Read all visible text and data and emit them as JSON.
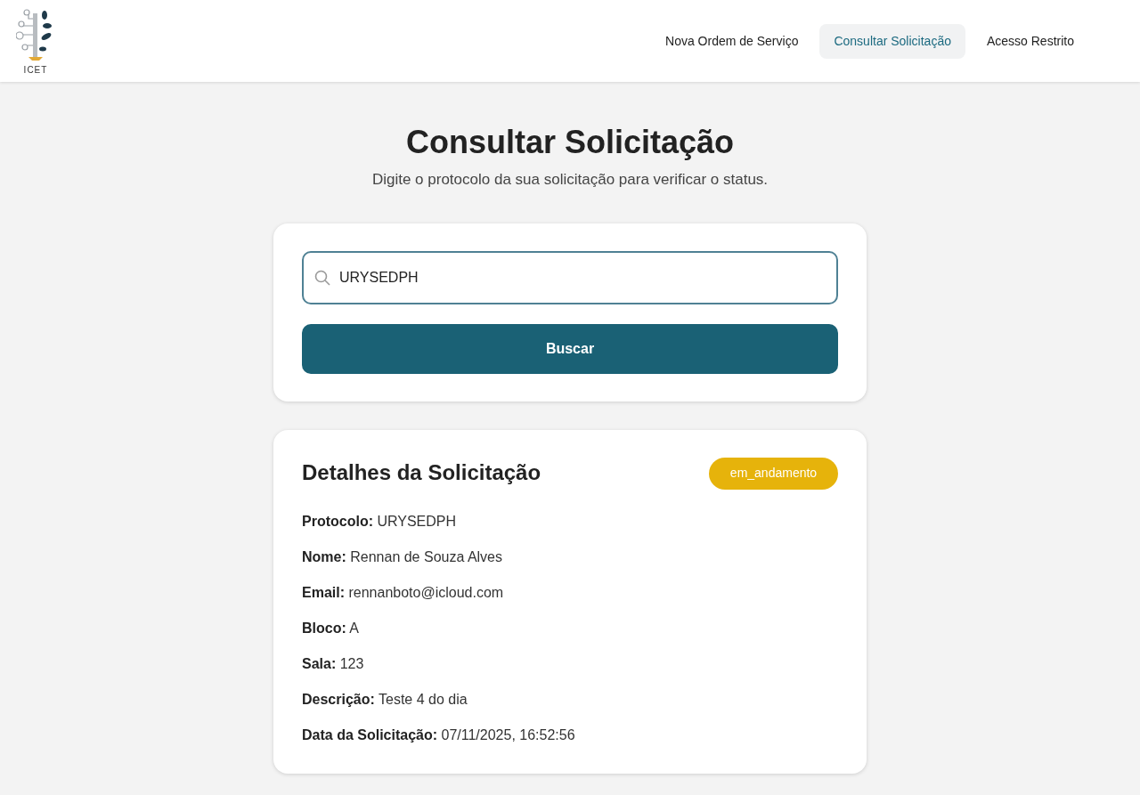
{
  "logo": {
    "text": "ICET"
  },
  "nav": [
    {
      "label": "Nova Ordem de Serviço",
      "selected": false
    },
    {
      "label": "Consultar Solicitação",
      "selected": true
    },
    {
      "label": "Acesso Restrito",
      "selected": false
    }
  ],
  "page": {
    "title": "Consultar Solicitação",
    "subtitle": "Digite o protocolo da sua solicitação para verificar o status."
  },
  "search": {
    "value": "URYSEDPH",
    "button": "Buscar"
  },
  "details": {
    "title": "Detalhes da Solicitação",
    "status": {
      "label": "em_andamento",
      "color": "#e6b30b"
    },
    "fields": [
      {
        "label": "Protocolo:",
        "value": "URYSEDPH"
      },
      {
        "label": "Nome:",
        "value": "Rennan de Souza Alves"
      },
      {
        "label": "Email:",
        "value": "rennanboto@icloud.com"
      },
      {
        "label": "Bloco:",
        "value": "A"
      },
      {
        "label": "Sala:",
        "value": "123"
      },
      {
        "label": "Descrição:",
        "value": "Teste 4 do dia"
      },
      {
        "label": "Data da Solicitação:",
        "value": "07/11/2025, 16:52:56"
      }
    ]
  }
}
